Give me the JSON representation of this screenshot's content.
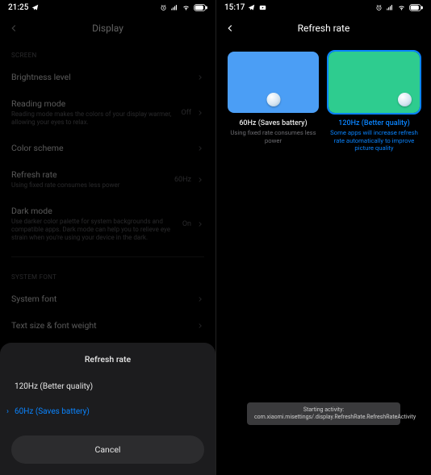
{
  "left": {
    "status": {
      "time": "21:25"
    },
    "title": "Display",
    "sections": {
      "screen": "SCREEN",
      "font": "SYSTEM FONT"
    },
    "rows": {
      "brightness": {
        "label": "Brightness level"
      },
      "reading": {
        "label": "Reading mode",
        "sub": "Reading mode makes the colors of your display warmer, allowing your eyes to relax.",
        "val": "Off"
      },
      "color": {
        "label": "Color scheme"
      },
      "refresh": {
        "label": "Refresh rate",
        "sub": "Using fixed rate consumes less power",
        "val": "60Hz"
      },
      "dark": {
        "label": "Dark mode",
        "sub": "Use darker color palette for system backgrounds and compatible apps. Dark mode can help you to relieve eye strain when you're using your device in the dark.",
        "val": "On"
      },
      "font": {
        "label": "System font"
      },
      "textsize": {
        "label": "Text size & font weight"
      }
    },
    "sheet": {
      "title": "Refresh rate",
      "opt1": "120Hz (Better quality)",
      "opt2": "60Hz (Saves battery)",
      "cancel": "Cancel"
    }
  },
  "right": {
    "status": {
      "time": "15:17"
    },
    "title": "Refresh rate",
    "cards": {
      "c60": {
        "title": "60Hz (Saves battery)",
        "sub": "Using fixed rate consumes less power"
      },
      "c120": {
        "title": "120Hz (Better quality)",
        "sub": "Some apps will increase refresh rate automatically to improve picture quality"
      }
    },
    "toast": "Starting activity: com.xiaomi.misettings/.display.RefreshRate.RefreshRateActivity"
  }
}
